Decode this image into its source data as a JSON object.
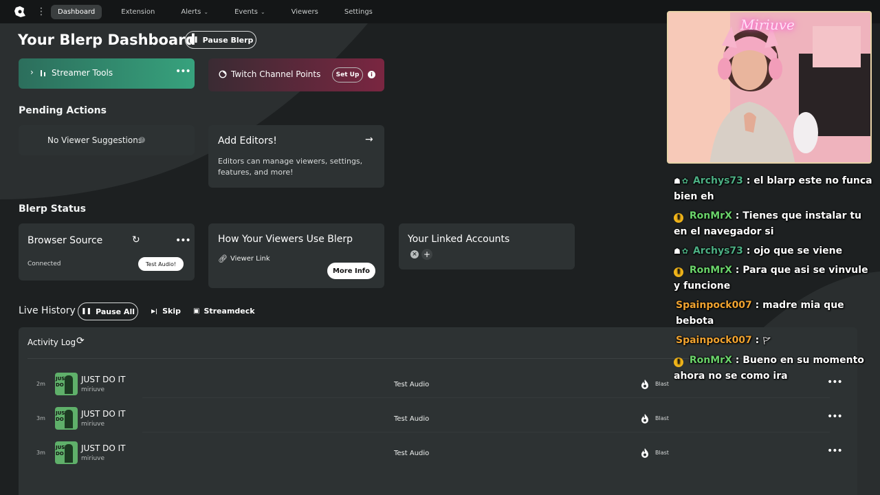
{
  "nav": {
    "tabs": [
      {
        "label": "Dashboard",
        "active": true
      },
      {
        "label": "Extension"
      },
      {
        "label": "Alerts",
        "dropdown": true
      },
      {
        "label": "Events",
        "dropdown": true
      },
      {
        "label": "Viewers"
      },
      {
        "label": "Settings"
      }
    ]
  },
  "header": {
    "title": "Your Blerp Dashboard",
    "pause_label": "Pause Blerp"
  },
  "tools": {
    "streamer_tools_label": "Streamer Tools",
    "twitch_label": "Twitch Channel Points",
    "setup_label": "Set Up"
  },
  "pending": {
    "heading": "Pending Actions",
    "no_suggestions": "No Viewer Suggestions",
    "editors_title": "Add Editors!",
    "editors_desc_line1": "Editors can manage viewers, settings,",
    "editors_desc_line2": "features, and more!"
  },
  "status": {
    "heading": "Blerp Status",
    "browser_source_title": "Browser Source",
    "connected": "Connected",
    "test_audio_btn": "Test Audio!",
    "viewers_use_title": "How Your Viewers Use Blerp",
    "viewer_link": "Viewer Link",
    "more_info": "More Info",
    "linked_accounts_title": "Your Linked Accounts"
  },
  "live": {
    "heading": "Live History",
    "pause_all": "Pause All",
    "skip": "Skip",
    "streamdeck": "Streamdeck",
    "activity_log": "Activity Log",
    "rows": [
      {
        "time": "2m",
        "title": "JUST DO IT",
        "user": "miriuve",
        "type": "Test Audio",
        "action": "Blast",
        "thumb_text": "JUST DO IT"
      },
      {
        "time": "3m",
        "title": "JUST DO IT",
        "user": "miriuve",
        "type": "Test Audio",
        "action": "Blast",
        "thumb_text": "JUST DO IT"
      },
      {
        "time": "3m",
        "title": "JUST DO IT",
        "user": "miriuve",
        "type": "Test Audio",
        "action": "Blast",
        "thumb_text": "JUST DO IT"
      }
    ]
  },
  "camera": {
    "neon_text": "Miriuve"
  },
  "chat": {
    "messages": [
      {
        "name": "Archys73",
        "name_color": "teal",
        "badge": "robot",
        "text": " : el blarp este no funca bien eh"
      },
      {
        "name": "RonMrX",
        "name_color": "green",
        "badge": "coin",
        "text": " : Tienes que instalar tu en el navegador si"
      },
      {
        "name": "Archys73",
        "name_color": "teal",
        "badge": "robot",
        "text": " : ojo que se viene"
      },
      {
        "name": "RonMrX",
        "name_color": "green",
        "badge": "coin",
        "text": " : Para que asi se vinvule y funcione"
      },
      {
        "name": "Spainpock007",
        "name_color": "orange",
        "badge": "",
        "text": " : madre mia que bebota"
      },
      {
        "name": "Spainpock007",
        "name_color": "orange",
        "badge": "",
        "text": " :"
      },
      {
        "name": "RonMrX",
        "name_color": "green",
        "badge": "coin",
        "text": " : Bueno en su momento ahora no se como ira"
      }
    ]
  },
  "colors": {
    "accent_green": "#37a27d",
    "twitch_red": "#7a2641",
    "chat_green": "#6ad36a",
    "chat_orange": "#f0a330"
  }
}
